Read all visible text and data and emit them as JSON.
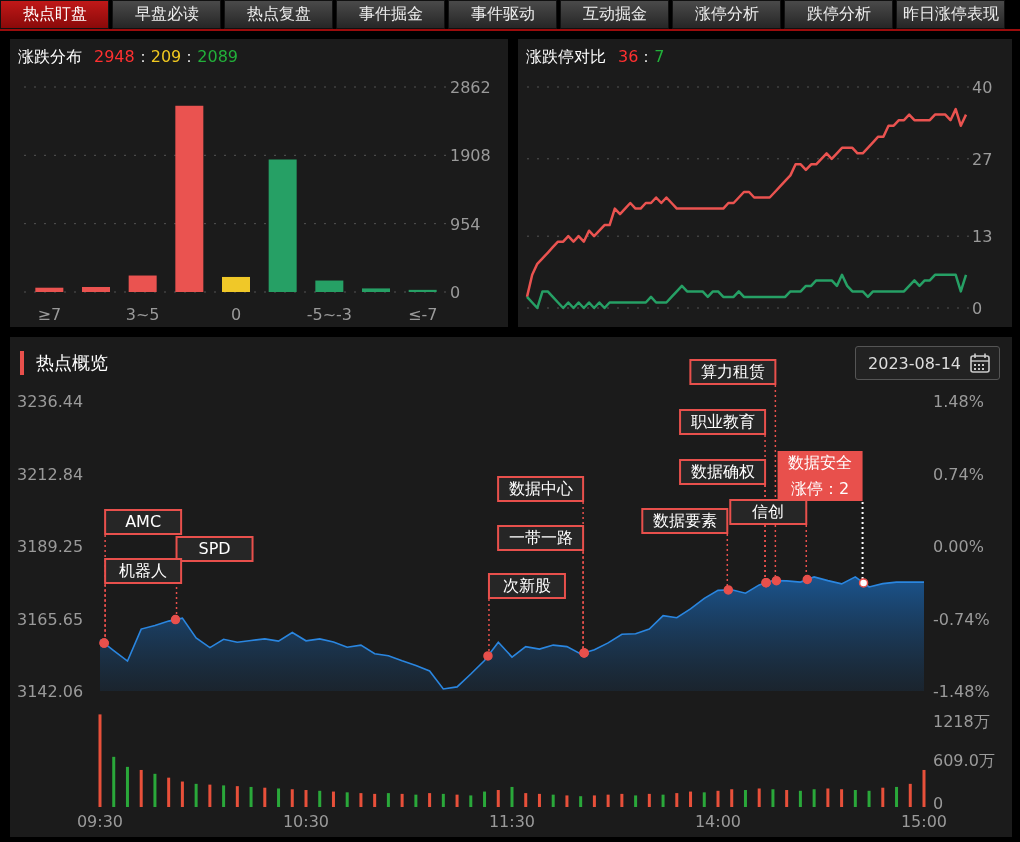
{
  "tabs": [
    {
      "label": "热点盯盘",
      "selected": true
    },
    {
      "label": "早盘必读",
      "selected": false
    },
    {
      "label": "热点复盘",
      "selected": false
    },
    {
      "label": "事件掘金",
      "selected": false
    },
    {
      "label": "事件驱动",
      "selected": false
    },
    {
      "label": "互动掘金",
      "selected": false
    },
    {
      "label": "涨停分析",
      "selected": false
    },
    {
      "label": "跌停分析",
      "selected": false
    },
    {
      "label": "昨日涨停表现",
      "selected": false
    }
  ],
  "distribution": {
    "title": "涨跌分布",
    "separator": "：",
    "counts": [
      {
        "value": "2948",
        "color": "#ff3030"
      },
      {
        "value": "209",
        "color": "#f0c820"
      },
      {
        "value": "2089",
        "color": "#22b03a"
      }
    ],
    "chart_data": {
      "type": "bar",
      "categories": [
        "≥7",
        null,
        "3~5",
        null,
        "0",
        null,
        "-5~-3",
        null,
        "≤-7"
      ],
      "ylim": [
        0,
        2862
      ],
      "yticks": [
        0,
        954,
        1908,
        2862
      ],
      "series": [
        {
          "color": "#ea5350",
          "values": [
            60,
            70,
            230,
            2600,
            null,
            null,
            null,
            null,
            null
          ]
        },
        {
          "color": "#f0c828",
          "values": [
            null,
            null,
            null,
            null,
            210,
            null,
            null,
            null,
            null
          ]
        },
        {
          "color": "#26a065",
          "values": [
            null,
            null,
            null,
            null,
            null,
            1850,
            160,
            50,
            30
          ]
        }
      ]
    }
  },
  "limits": {
    "title": "涨跌停对比",
    "separator": "：",
    "counts": [
      {
        "value": "36",
        "color": "#ff3030"
      },
      {
        "value": "7",
        "color": "#22b03a"
      }
    ],
    "chart_data": {
      "type": "line",
      "ylim": [
        0,
        40
      ],
      "yticks": [
        0,
        13,
        27,
        40
      ],
      "series": [
        {
          "color": "#ea5350",
          "values": [
            2,
            6,
            8,
            9,
            10,
            11,
            12,
            12,
            13,
            12,
            13,
            12,
            14,
            13,
            14,
            15,
            15,
            18,
            17,
            18,
            19,
            18,
            18,
            19,
            19,
            20,
            19,
            20,
            19,
            18,
            18,
            18,
            18,
            18,
            18,
            18,
            18,
            18,
            18,
            19,
            19,
            20,
            21,
            21,
            20,
            20,
            20,
            20,
            21,
            22,
            23,
            24,
            26,
            26,
            25,
            26,
            26,
            27,
            28,
            27,
            28,
            29,
            29,
            29,
            28,
            28,
            29,
            30,
            31,
            31,
            33,
            33,
            34,
            34,
            35,
            34,
            34,
            34,
            34,
            35,
            35,
            35,
            34,
            36,
            33,
            35
          ]
        },
        {
          "color": "#26a065",
          "values": [
            2,
            1,
            0,
            3,
            3,
            2,
            1,
            0,
            1,
            0,
            1,
            0,
            1,
            0,
            1,
            0,
            1,
            1,
            1,
            1,
            1,
            1,
            1,
            1,
            2,
            1,
            1,
            1,
            2,
            3,
            4,
            3,
            3,
            3,
            3,
            2,
            3,
            3,
            2,
            2,
            2,
            3,
            2,
            2,
            2,
            2,
            2,
            2,
            2,
            2,
            2,
            3,
            3,
            3,
            4,
            4,
            5,
            5,
            5,
            5,
            4,
            6,
            4,
            3,
            3,
            3,
            2,
            3,
            3,
            3,
            3,
            3,
            3,
            3,
            4,
            5,
            4,
            5,
            5,
            6,
            6,
            6,
            6,
            6,
            3,
            6
          ]
        }
      ]
    }
  },
  "overview": {
    "title": "热点概览",
    "date": "2023-08-14",
    "right_axis": [
      "1.48%",
      "0.74%",
      "0.00%",
      "-0.74%",
      "-1.48%"
    ],
    "chart_data": {
      "type": "area",
      "ylim": [
        3142.06,
        3236.44
      ],
      "categories": [
        null,
        null,
        null,
        null,
        null,
        null,
        null,
        null,
        null,
        null,
        null,
        null,
        null,
        null,
        null,
        null,
        null,
        null,
        null,
        null,
        null,
        null,
        null,
        null,
        null,
        null,
        null,
        null,
        null,
        null,
        null,
        null,
        null,
        null,
        null,
        null,
        null,
        null,
        null,
        null,
        null,
        null,
        null,
        null,
        null,
        null,
        null,
        null,
        null,
        null,
        null,
        null,
        null,
        null,
        null,
        null,
        null,
        null,
        null,
        null,
        null
      ],
      "yticks": [
        {
          "value": 3236.44,
          "label": "3236.44"
        },
        {
          "value": 3212.84,
          "label": "3212.84"
        },
        {
          "value": 3189.25,
          "label": "3189.25"
        },
        {
          "value": 3165.65,
          "label": "3165.65"
        },
        {
          "value": 3142.06,
          "label": "3142.06"
        }
      ],
      "series": [
        {
          "color": "#2a86e0",
          "values": [
            3158.7,
            3155.2,
            3151.8,
            3162.2,
            3163.4,
            3164.8,
            3165.8,
            3159.3,
            3156.2,
            3158.9,
            3157.9,
            3158.5,
            3159.0,
            3158.3,
            3161.1,
            3158.4,
            3159.0,
            3158.0,
            3156.3,
            3157.0,
            3154.2,
            3153.5,
            3151.9,
            3150.4,
            3148.6,
            3142.7,
            3143.4,
            3147.6,
            3152.0,
            3157.9,
            3153.1,
            3156.5,
            3155.7,
            3157.0,
            3156.5,
            3154.1,
            3155.5,
            3157.7,
            3160.5,
            3160.7,
            3162.2,
            3166.6,
            3165.9,
            3168.8,
            3172.2,
            3174.8,
            3175.0,
            3173.9,
            3176.6,
            3178.0,
            3177.9,
            3177.5,
            3179.2,
            3178.0,
            3176.9,
            3179.2,
            3175.9,
            3177.0,
            3177.5,
            3177.5,
            3177.5
          ]
        }
      ]
    },
    "hotspots": [
      {
        "label": "AMC",
        "selected": false
      },
      {
        "label": "SPD",
        "selected": false
      },
      {
        "label": "机器人",
        "selected": false
      },
      {
        "label": "数据中心",
        "selected": false
      },
      {
        "label": "一带一路",
        "selected": false
      },
      {
        "label": "次新股",
        "selected": false
      },
      {
        "label": "算力租赁",
        "selected": false
      },
      {
        "label": "职业教育",
        "selected": false
      },
      {
        "label": "数据确权",
        "selected": false
      },
      {
        "label": "数据要素",
        "selected": false
      },
      {
        "label": "信创",
        "selected": false
      },
      {
        "label": "数据安全",
        "note": "涨停：2",
        "selected": true
      }
    ]
  },
  "volume": {
    "chart_data": {
      "type": "bar",
      "ylim": [
        0,
        1218
      ],
      "yticks": [
        {
          "value": 1218,
          "label": "1218万"
        },
        {
          "value": 609,
          "label": "609.0万"
        },
        0
      ],
      "categories": [
        "09:30",
        null,
        null,
        null,
        null,
        null,
        null,
        null,
        null,
        null,
        null,
        null,
        null,
        null,
        null,
        "10:30",
        null,
        null,
        null,
        null,
        null,
        null,
        null,
        null,
        null,
        null,
        null,
        null,
        null,
        null,
        "11:30",
        null,
        null,
        null,
        null,
        null,
        null,
        null,
        null,
        null,
        null,
        null,
        null,
        null,
        null,
        "14:00",
        null,
        null,
        null,
        null,
        null,
        null,
        null,
        null,
        null,
        null,
        null,
        null,
        null,
        null,
        "15:00"
      ],
      "series": [
        {
          "color": "#e8503a",
          "values": [
            1200,
            null,
            null,
            480,
            null,
            380,
            330,
            null,
            290,
            null,
            270,
            null,
            250,
            null,
            230,
            220,
            null,
            200,
            null,
            180,
            170,
            null,
            170,
            null,
            180,
            null,
            160,
            null,
            null,
            220,
            null,
            180,
            170,
            null,
            150,
            null,
            150,
            160,
            170,
            null,
            170,
            null,
            180,
            200,
            null,
            210,
            230,
            null,
            240,
            null,
            220,
            null,
            null,
            240,
            230,
            null,
            null,
            250,
            null,
            300,
            480
          ]
        },
        {
          "color": "#2aa83a",
          "values": [
            null,
            650,
            520,
            null,
            430,
            null,
            null,
            300,
            null,
            280,
            null,
            260,
            null,
            240,
            null,
            null,
            210,
            null,
            190,
            null,
            null,
            180,
            null,
            160,
            null,
            170,
            null,
            150,
            200,
            null,
            260,
            null,
            null,
            160,
            null,
            140,
            null,
            null,
            null,
            150,
            null,
            160,
            null,
            null,
            190,
            null,
            null,
            220,
            null,
            230,
            null,
            210,
            230,
            null,
            null,
            220,
            210,
            null,
            260,
            null,
            null
          ]
        }
      ]
    }
  }
}
